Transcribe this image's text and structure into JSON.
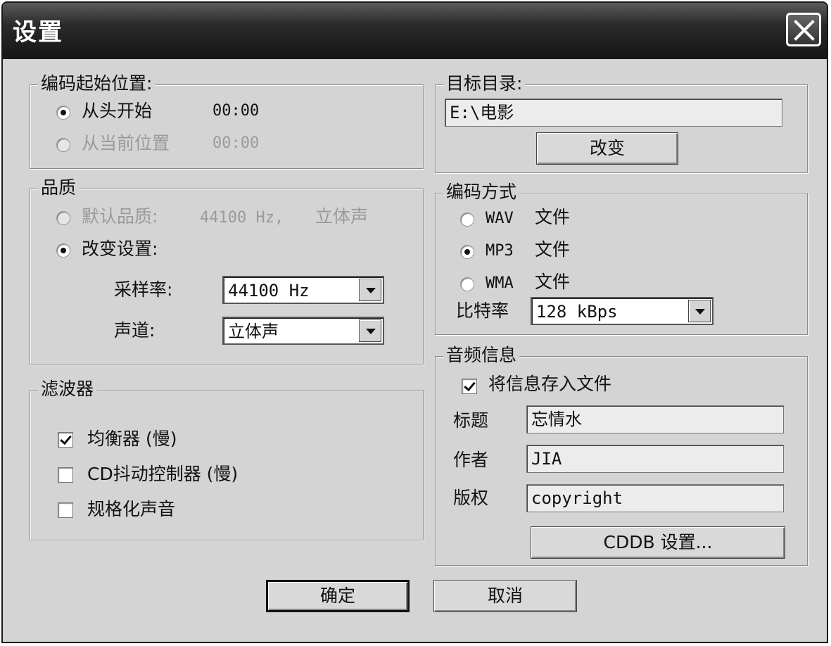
{
  "window": {
    "title": "设置"
  },
  "start_position": {
    "legend": "编码起始位置:",
    "from_start": {
      "label": "从头开始",
      "time": "00:00",
      "checked": true
    },
    "from_current": {
      "label": "从当前位置",
      "time": "00:00",
      "checked": false,
      "disabled": true
    }
  },
  "quality": {
    "legend": "品质",
    "default": {
      "label": "默认品质:",
      "detail": "44100 Hz,",
      "channel": "立体声",
      "disabled": true
    },
    "custom": {
      "label": "改变设置:",
      "checked": true
    },
    "sample_rate": {
      "label": "采样率:",
      "value": "44100 Hz"
    },
    "channel": {
      "label": "声道:",
      "value": "立体声"
    }
  },
  "filters": {
    "legend": "滤波器",
    "items": [
      {
        "label": "均衡器 (慢)",
        "checked": true
      },
      {
        "label": "CD抖动控制器 (慢)",
        "checked": false
      },
      {
        "label": "规格化声音",
        "checked": false
      }
    ]
  },
  "target_dir": {
    "legend": "目标目录:",
    "path": "E:\\电影",
    "change_button": "改变"
  },
  "encoding": {
    "legend": "编码方式",
    "options": [
      {
        "format": "WAV",
        "label": "文件",
        "checked": false
      },
      {
        "format": "MP3",
        "label": "文件",
        "checked": true
      },
      {
        "format": "WMA",
        "label": "文件",
        "checked": false
      }
    ],
    "bitrate": {
      "label": "比特率",
      "value": "128 kBps"
    }
  },
  "audio_info": {
    "legend": "音频信息",
    "save_to_file": {
      "label": "将信息存入文件",
      "checked": true
    },
    "title": {
      "label": "标题",
      "value": "忘情水"
    },
    "author": {
      "label": "作者",
      "value": "JIA"
    },
    "copyright": {
      "label": "版权",
      "value": "copyright"
    },
    "cddb_button": "CDDB 设置..."
  },
  "footer": {
    "ok": "确定",
    "cancel": "取消"
  }
}
